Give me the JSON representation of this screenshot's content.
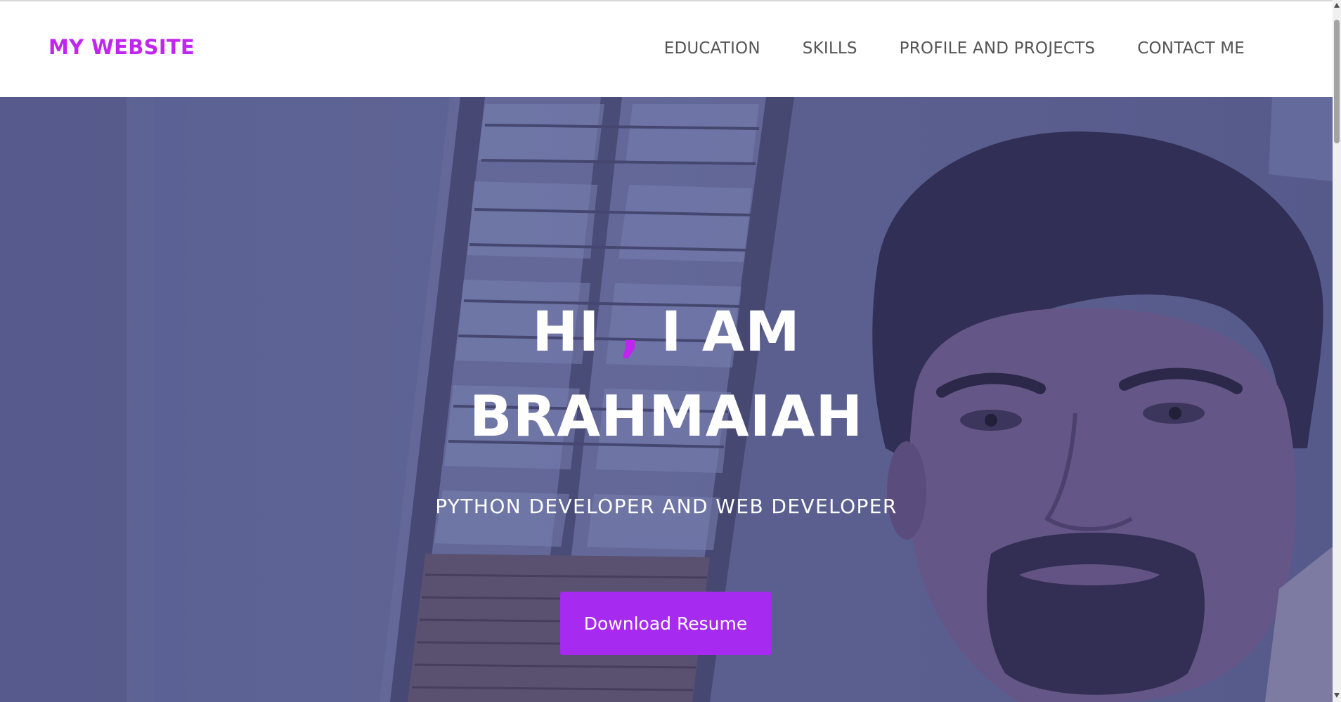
{
  "navbar": {
    "brand": "MY WEBSITE",
    "links": [
      {
        "label": "EDUCATION"
      },
      {
        "label": "SKILLS"
      },
      {
        "label": "PROFILE AND PROJECTS"
      },
      {
        "label": "CONTACT ME"
      }
    ]
  },
  "hero": {
    "greeting_part1": "HI ",
    "greeting_comma": ",",
    "greeting_part2": " I AM",
    "name": "BRAHMAIAH",
    "subtitle": "PYTHON DEVELOPER AND WEB DEVELOPER",
    "button_label": "Download Resume"
  },
  "colors": {
    "accent": "#c026f0",
    "button": "#a62af0",
    "nav_text": "#555555",
    "hero_tint": "#5f6592"
  }
}
